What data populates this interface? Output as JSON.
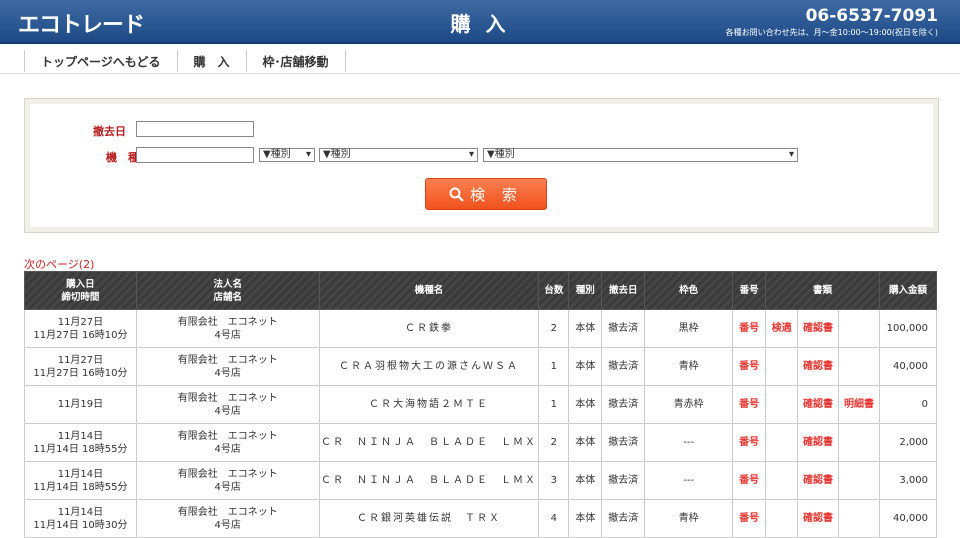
{
  "header": {
    "logo": "エコトレード",
    "title": "購 入",
    "phone": "06-6537-7091",
    "hours": "各種お問い合わせ先は、月～金10:00～19:00(祝日を除く)"
  },
  "nav": [
    {
      "label": "トップページへもどる"
    },
    {
      "label": "購　入"
    },
    {
      "label": "枠･店舗移動"
    }
  ],
  "search": {
    "date_label": "撤去日",
    "model_label": "機　種",
    "select1": "▼種別",
    "select2": "▼種別",
    "select3": "▼種別",
    "button_label": "検 索"
  },
  "next_page": "次のページ(2)",
  "table": {
    "headers": {
      "date": "購入日",
      "date_sub": "締切時間",
      "corp": "法人名",
      "corp_sub": "店舗名",
      "model": "機種名",
      "qty": "台数",
      "type": "種別",
      "removal": "撤去日",
      "frame": "枠色",
      "number": "番号",
      "docs": "書類",
      "amount": "購入金額"
    },
    "rows": [
      {
        "date": "11月27日",
        "deadline": "11月27日 16時10分",
        "corp": "有限会社　エコネット",
        "store": "4号店",
        "model": "ＣＲ鉄拳",
        "qty": "2",
        "type": "本体",
        "removal": "撤去済",
        "frame": "黒枠",
        "number": "番号",
        "doc1": "検適",
        "doc2": "確認書",
        "doc3": "",
        "amount": "100,000"
      },
      {
        "date": "11月27日",
        "deadline": "11月27日 16時10分",
        "corp": "有限会社　エコネット",
        "store": "4号店",
        "model": "ＣＲＡ羽根物大工の源さんＷＳＡ",
        "qty": "1",
        "type": "本体",
        "removal": "撤去済",
        "frame": "青枠",
        "number": "番号",
        "doc1": "",
        "doc2": "確認書",
        "doc3": "",
        "amount": "40,000"
      },
      {
        "date": "11月19日",
        "deadline": "",
        "corp": "有限会社　エコネット",
        "store": "4号店",
        "model": "ＣＲ大海物語２ＭＴＥ",
        "qty": "1",
        "type": "本体",
        "removal": "撤去済",
        "frame": "青赤枠",
        "number": "番号",
        "doc1": "",
        "doc2": "確認書",
        "doc3": "明細書",
        "amount": "0"
      },
      {
        "date": "11月14日",
        "deadline": "11月14日 18時55分",
        "corp": "有限会社　エコネット",
        "store": "4号店",
        "model": "ＣＲ　ＮＩＮＪＡ　ＢＬＡＤＥ　ＬＭＸ",
        "qty": "2",
        "type": "本体",
        "removal": "撤去済",
        "frame": "---",
        "number": "番号",
        "doc1": "",
        "doc2": "確認書",
        "doc3": "",
        "amount": "2,000"
      },
      {
        "date": "11月14日",
        "deadline": "11月14日 18時55分",
        "corp": "有限会社　エコネット",
        "store": "4号店",
        "model": "ＣＲ　ＮＩＮＪＡ　ＢＬＡＤＥ　ＬＭＸ",
        "qty": "3",
        "type": "本体",
        "removal": "撤去済",
        "frame": "---",
        "number": "番号",
        "doc1": "",
        "doc2": "確認書",
        "doc3": "",
        "amount": "3,000"
      },
      {
        "date": "11月14日",
        "deadline": "11月14日 10時30分",
        "corp": "有限会社　エコネット",
        "store": "4号店",
        "model": "ＣＲ銀河英雄伝説　ＴＲＸ",
        "qty": "4",
        "type": "本体",
        "removal": "撤去済",
        "frame": "青枠",
        "number": "番号",
        "doc1": "",
        "doc2": "確認書",
        "doc3": "",
        "amount": "40,000"
      }
    ]
  }
}
